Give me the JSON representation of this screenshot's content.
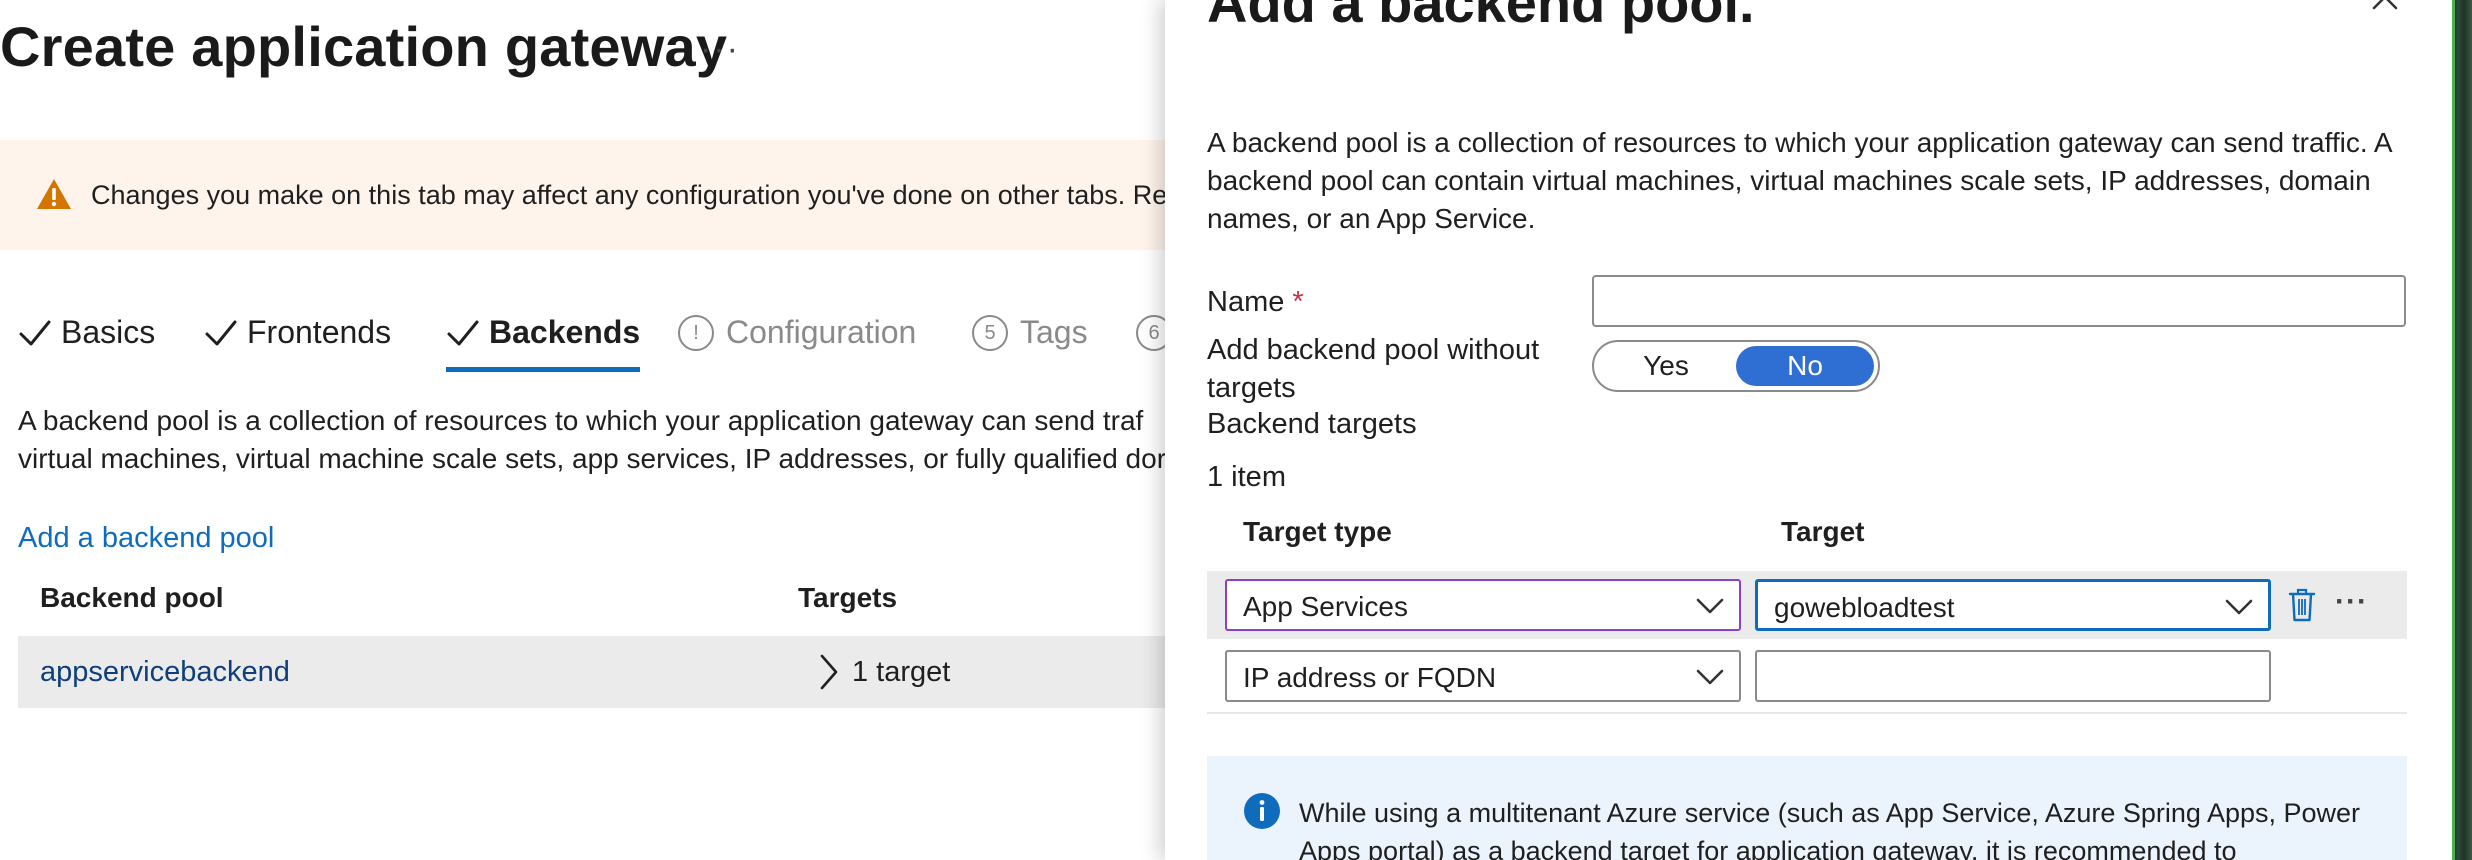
{
  "main": {
    "title": "Create application gateway",
    "more_label": "···",
    "warning": "Changes you make on this tab may affect any configuration you've done on other tabs. Revi",
    "tabs": [
      {
        "label": "Basics",
        "state": "complete"
      },
      {
        "label": "Frontends",
        "state": "complete"
      },
      {
        "label": "Backends",
        "state": "active"
      },
      {
        "label": "Configuration",
        "state": "disabled",
        "marker": "!"
      },
      {
        "label": "Tags",
        "state": "disabled",
        "marker": "5"
      },
      {
        "label": "",
        "state": "disabled",
        "marker": "6"
      }
    ],
    "description_line1": "A backend pool is a collection of resources to which your application gateway can send traf",
    "description_line2": "virtual machines, virtual machine scale sets, app services, IP addresses, or fully qualified dor",
    "add_pool_link": "Add a backend pool",
    "table": {
      "headers": [
        "Backend pool",
        "Targets"
      ],
      "rows": [
        {
          "pool": "appservicebackend",
          "targets": "1 target"
        }
      ]
    }
  },
  "blade": {
    "title": "Add a backend pool.",
    "description": "A backend pool is a collection of resources to which your application gateway can send traffic. A backend pool can contain virtual machines, virtual machines scale sets, IP addresses, domain names, or an App Service.",
    "name_label": "Name",
    "required_mark": "*",
    "name_value": "",
    "without_targets_label": "Add backend pool without targets",
    "toggle": {
      "yes": "Yes",
      "no": "No",
      "selected": "No"
    },
    "backend_targets_label": "Backend targets",
    "item_count": "1 item",
    "columns": {
      "type": "Target type",
      "target": "Target"
    },
    "rows": [
      {
        "type": "App Services",
        "target": "gowebloadtest"
      },
      {
        "type": "IP address or FQDN",
        "target": ""
      }
    ],
    "info": "While using a multitenant Azure service (such as App Service, Azure Spring Apps, Power Apps portal) as a backend target for application gateway, it is recommended to"
  },
  "colors": {
    "accent": "#0f6cbd",
    "toggle_on": "#2f6fd3",
    "warning_bg": "#fff4ec",
    "warning_icon": "#d47500",
    "info_bg": "#ebf3fc",
    "info_icon": "#0f6cbd",
    "row_bg": "#ebebeb",
    "focus_purple": "#8c3fc7"
  },
  "icons": [
    "more-icon",
    "warning-icon",
    "check-icon",
    "chevron-right-icon",
    "close-icon",
    "chevron-down-icon",
    "delete-icon",
    "ellipsis-icon",
    "info-icon"
  ]
}
